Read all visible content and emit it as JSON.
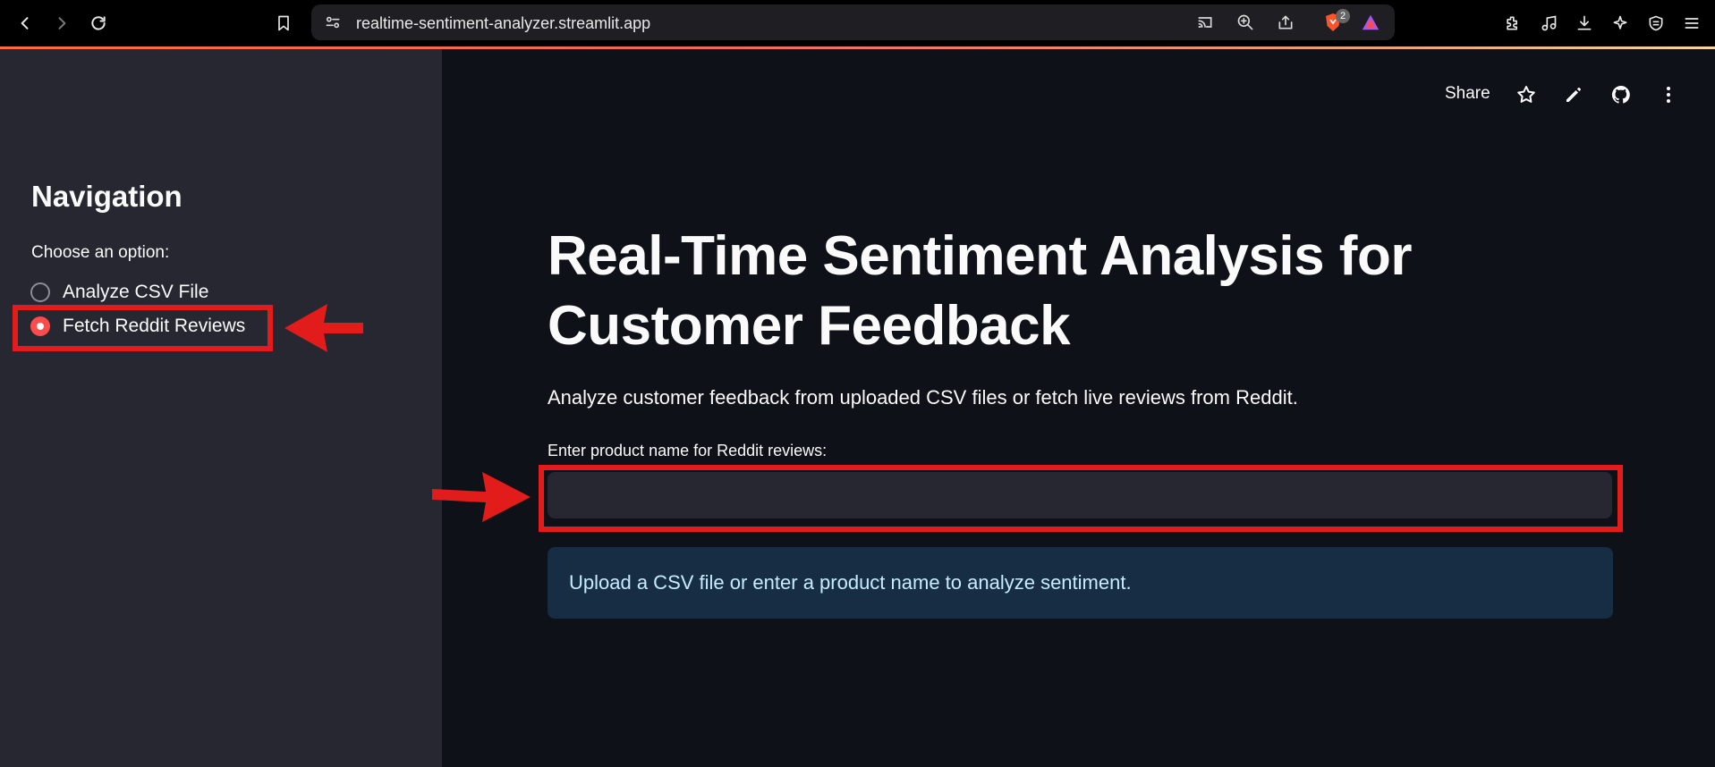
{
  "browser": {
    "url": "realtime-sentiment-analyzer.streamlit.app",
    "brave_badge_count": "2"
  },
  "sidebar": {
    "title": "Navigation",
    "radio_caption": "Choose an option:",
    "options": [
      {
        "label": "Analyze CSV File",
        "selected": false
      },
      {
        "label": "Fetch Reddit Reviews",
        "selected": true
      }
    ]
  },
  "header": {
    "share_label": "Share"
  },
  "main": {
    "title": "Real-Time Sentiment Analysis for Customer Feedback",
    "description": "Analyze customer feedback from uploaded CSV files or fetch live reviews from Reddit.",
    "input_label": "Enter product name for Reddit reviews:",
    "input_value": "",
    "info_message": "Upload a CSV file or enter a product name to analyze sentiment."
  },
  "colors": {
    "background": "#0e1117",
    "sidebar": "#262730",
    "accent": "#ff4b4b",
    "annotation_red": "#e21b1b",
    "info_bg": "#172d43",
    "info_text": "#c7ebff"
  }
}
